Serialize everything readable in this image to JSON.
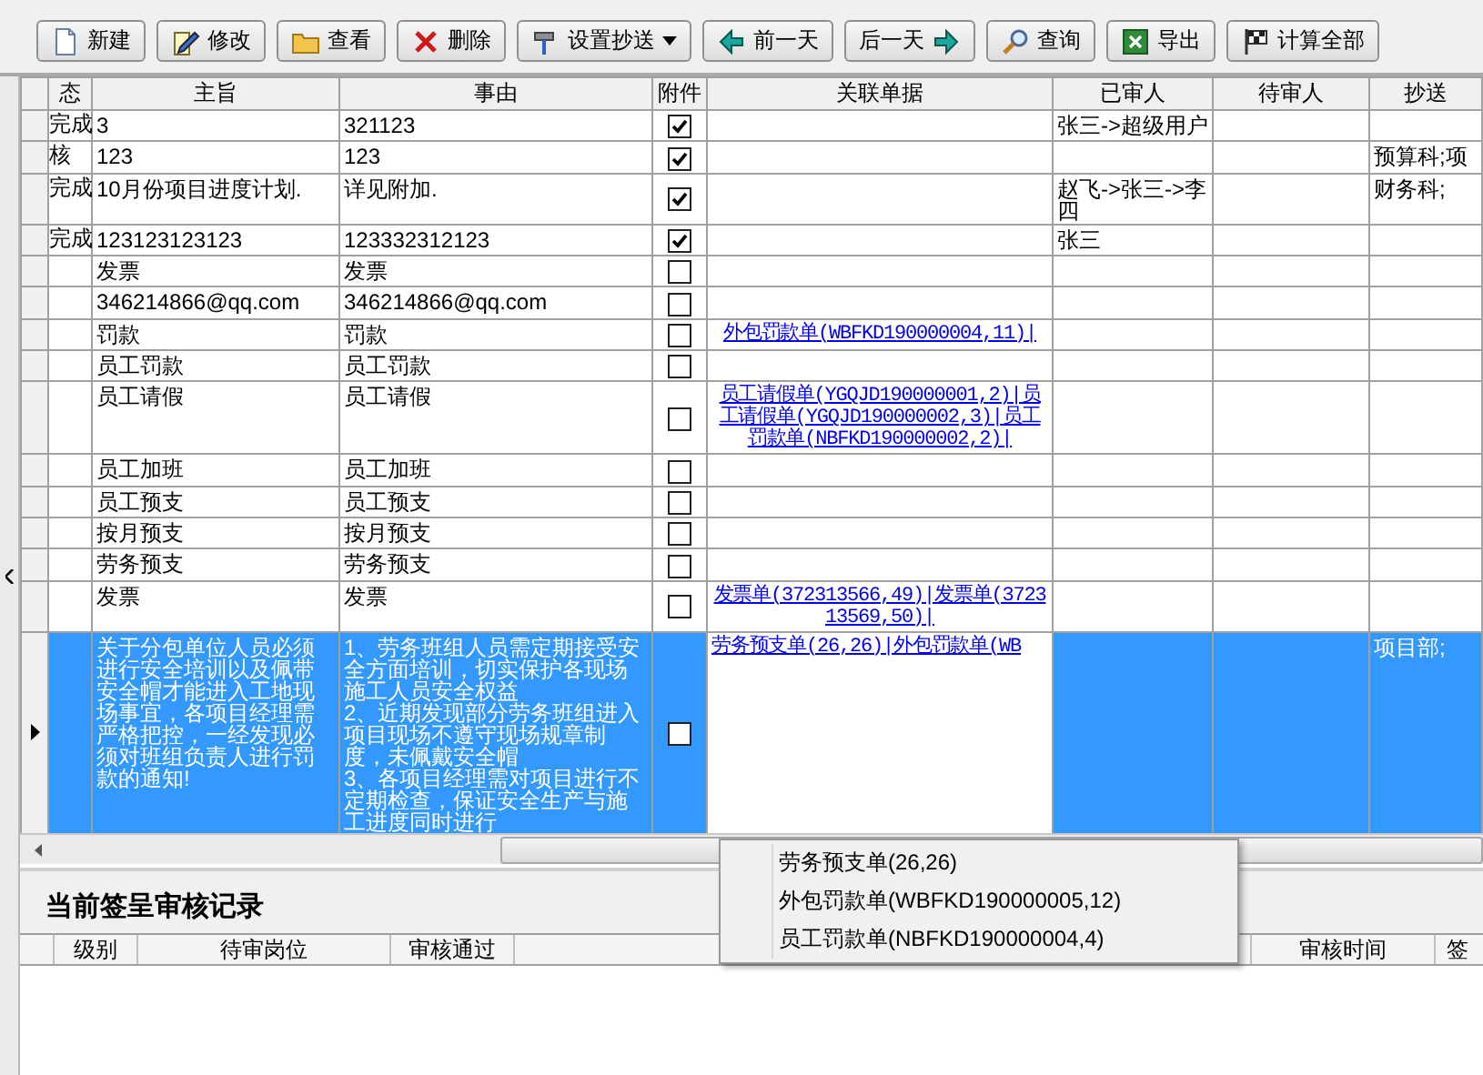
{
  "toolbar": {
    "buttons": [
      {
        "label": "新建",
        "dropdown": false
      },
      {
        "label": "修改",
        "dropdown": false
      },
      {
        "label": "查看",
        "dropdown": false
      },
      {
        "label": "删除",
        "dropdown": false
      },
      {
        "label": "设置抄送",
        "dropdown": true
      },
      {
        "label": "前一天",
        "dropdown": false
      },
      {
        "label": "后一天",
        "dropdown": false
      },
      {
        "label": "查询",
        "dropdown": false
      },
      {
        "label": "导出",
        "dropdown": false
      },
      {
        "label": "计算全部",
        "dropdown": false
      }
    ]
  },
  "grid": {
    "columns": [
      "态",
      "主旨",
      "事由",
      "附件",
      "关联单据",
      "已审人",
      "待审人",
      "抄送"
    ],
    "rows": [
      {
        "status": "完成",
        "subject": "3",
        "reason": "321123",
        "attachment": true,
        "reviewed": "张三->超级用户",
        "selected": false
      },
      {
        "status": "核",
        "subject": "123",
        "reason": "123",
        "attachment": true,
        "cc": "预算科;项",
        "selected": false
      },
      {
        "status": "完成",
        "subject": "10月份项目进度计划.",
        "reason": "详见附加.",
        "attachment": true,
        "reviewed": "赵飞->张三->李四",
        "cc": "财务科;",
        "selected": false
      },
      {
        "status": "完成",
        "subject": "123123123123",
        "reason": "123332312123",
        "attachment": true,
        "reviewed": "张三",
        "selected": false
      },
      {
        "subject": "发票",
        "reason": "发票",
        "attachment": false,
        "selected": false
      },
      {
        "subject": "346214866@qq.com",
        "reason": "346214866@qq.com",
        "attachment": false,
        "selected": false
      },
      {
        "subject": "罚款",
        "reason": "罚款",
        "attachment": false,
        "links": "外包罚款单(WBFKD190000004,11)|",
        "selected": false
      },
      {
        "subject": "员工罚款",
        "reason": "员工罚款",
        "attachment": false,
        "selected": false
      },
      {
        "subject": "员工请假",
        "reason": "员工请假",
        "attachment": false,
        "links": "员工请假单(YGQJD190000001,2)|员工请假单(YGQJD190000002,3)|员工罚款单(NBFKD190000002,2)|",
        "selected": false
      },
      {
        "subject": "员工加班",
        "reason": "员工加班",
        "attachment": false,
        "selected": false
      },
      {
        "subject": "员工预支",
        "reason": "员工预支",
        "attachment": false,
        "selected": false
      },
      {
        "subject": "按月预支",
        "reason": "按月预支",
        "attachment": false,
        "selected": false
      },
      {
        "subject": "劳务预支",
        "reason": "劳务预支",
        "attachment": false,
        "selected": false
      },
      {
        "subject": "发票",
        "reason": "发票",
        "attachment": false,
        "links": "发票单(372313566,49)|发票单(372313569,50)|",
        "selected": false
      },
      {
        "subject": "关于分包单位人员必须进行安全培训以及佩带安全帽才能进入工地现场事宜，各项目经理需严格把控，一经发现必须对班组负责人进行罚款的通知!",
        "reason": "1、劳务班组人员需定期接受安全方面培训，切实保护各现场施工人员安全权益\n2、近期发现部分劳务班组进入项目现场不遵守现场规章制度，未佩戴安全帽\n3、各项目经理需对项目进行不定期检查，保证安全生产与施工进度同时进行",
        "attachment": false,
        "links": "劳务预支单(26,26)|外包罚款单(WB",
        "cc": "项目部;",
        "selected": true
      }
    ]
  },
  "link_menu": {
    "items": [
      "劳务预支单(26,26)",
      "外包罚款单(WBFKD190000005,12)",
      "员工罚款单(NBFKD190000004,4)"
    ]
  },
  "review_panel": {
    "title": "当前签呈审核记录",
    "columns": [
      "级别",
      "待审岗位",
      "审核通过",
      "审核时间",
      "签"
    ]
  }
}
